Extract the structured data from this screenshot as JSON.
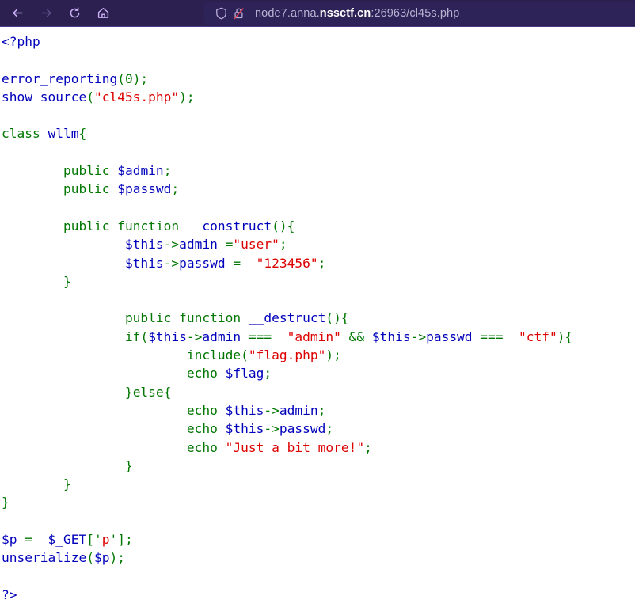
{
  "browser": {
    "back_label": "Back",
    "forward_label": "Forward",
    "reload_label": "Reload",
    "home_label": "Home",
    "shield_label": "Enhanced Tracking Protection",
    "lock_label": "Connection is not secure",
    "url_full": "node7.anna.nssctf.cn:26963/cl45s.php",
    "url_prefix": "node7.anna.",
    "url_host_strong": "nssctf.cn",
    "url_suffix": ":26963/cl45s.php",
    "icons": {
      "back": "arrow-left-icon",
      "forward": "arrow-right-icon",
      "reload": "reload-icon",
      "home": "home-icon",
      "shield": "shield-icon",
      "lock": "lock-crossed-icon"
    },
    "colors": {
      "chrome_bg": "#2b2050",
      "urlbar_bg": "#2e2358",
      "icon": "#c7a8f0",
      "url_text": "#b7b2d0",
      "url_host": "#ffffff"
    }
  },
  "page": {
    "title": "cl45s.php source",
    "colors": {
      "default": "#0000bb",
      "keyword": "#007700",
      "string": "#dd0000",
      "background": "#ffffff"
    },
    "code_lines": [
      [
        {
          "t": "<?php",
          "c": "default"
        }
      ],
      [],
      [
        {
          "t": "error_reporting",
          "c": "default"
        },
        {
          "t": "(",
          "c": "keyword"
        },
        {
          "t": "0",
          "c": "keyword"
        },
        {
          "t": ");",
          "c": "keyword"
        }
      ],
      [
        {
          "t": "show_source",
          "c": "default"
        },
        {
          "t": "(",
          "c": "keyword"
        },
        {
          "t": "\"cl45s.php\"",
          "c": "string"
        },
        {
          "t": ");",
          "c": "keyword"
        }
      ],
      [],
      [
        {
          "t": "class",
          "c": "keyword"
        },
        {
          "t": " ",
          "c": "keyword"
        },
        {
          "t": "wllm",
          "c": "default"
        },
        {
          "t": "{",
          "c": "keyword"
        }
      ],
      [],
      [
        {
          "t": "        ",
          "c": "keyword"
        },
        {
          "t": "public",
          "c": "keyword"
        },
        {
          "t": " ",
          "c": "keyword"
        },
        {
          "t": "$admin",
          "c": "default"
        },
        {
          "t": ";",
          "c": "keyword"
        }
      ],
      [
        {
          "t": "        ",
          "c": "keyword"
        },
        {
          "t": "public",
          "c": "keyword"
        },
        {
          "t": " ",
          "c": "keyword"
        },
        {
          "t": "$passwd",
          "c": "default"
        },
        {
          "t": ";",
          "c": "keyword"
        }
      ],
      [],
      [
        {
          "t": "        ",
          "c": "keyword"
        },
        {
          "t": "public",
          "c": "keyword"
        },
        {
          "t": " ",
          "c": "keyword"
        },
        {
          "t": "function",
          "c": "keyword"
        },
        {
          "t": " ",
          "c": "keyword"
        },
        {
          "t": "__construct",
          "c": "default"
        },
        {
          "t": "(){",
          "c": "keyword"
        }
      ],
      [
        {
          "t": "                ",
          "c": "keyword"
        },
        {
          "t": "$this",
          "c": "default"
        },
        {
          "t": "->",
          "c": "keyword"
        },
        {
          "t": "admin",
          "c": "default"
        },
        {
          "t": " =",
          "c": "keyword"
        },
        {
          "t": "\"user\"",
          "c": "string"
        },
        {
          "t": ";",
          "c": "keyword"
        }
      ],
      [
        {
          "t": "                ",
          "c": "keyword"
        },
        {
          "t": "$this",
          "c": "default"
        },
        {
          "t": "->",
          "c": "keyword"
        },
        {
          "t": "passwd",
          "c": "default"
        },
        {
          "t": " = ",
          "c": "keyword"
        },
        {
          "t": " \"123456\"",
          "c": "string"
        },
        {
          "t": ";",
          "c": "keyword"
        }
      ],
      [
        {
          "t": "        }",
          "c": "keyword"
        }
      ],
      [],
      [
        {
          "t": "                ",
          "c": "keyword"
        },
        {
          "t": "public",
          "c": "keyword"
        },
        {
          "t": " ",
          "c": "keyword"
        },
        {
          "t": "function",
          "c": "keyword"
        },
        {
          "t": " ",
          "c": "keyword"
        },
        {
          "t": "__destruct",
          "c": "default"
        },
        {
          "t": "(){",
          "c": "keyword"
        }
      ],
      [
        {
          "t": "                ",
          "c": "keyword"
        },
        {
          "t": "if",
          "c": "keyword"
        },
        {
          "t": "(",
          "c": "keyword"
        },
        {
          "t": "$this",
          "c": "default"
        },
        {
          "t": "->",
          "c": "keyword"
        },
        {
          "t": "admin",
          "c": "default"
        },
        {
          "t": " === ",
          "c": "keyword"
        },
        {
          "t": " \"admin\"",
          "c": "string"
        },
        {
          "t": " && ",
          "c": "keyword"
        },
        {
          "t": "$this",
          "c": "default"
        },
        {
          "t": "->",
          "c": "keyword"
        },
        {
          "t": "passwd",
          "c": "default"
        },
        {
          "t": " === ",
          "c": "keyword"
        },
        {
          "t": " \"ctf\"",
          "c": "string"
        },
        {
          "t": "){",
          "c": "keyword"
        }
      ],
      [
        {
          "t": "                        ",
          "c": "keyword"
        },
        {
          "t": "include",
          "c": "keyword"
        },
        {
          "t": "(",
          "c": "keyword"
        },
        {
          "t": "\"flag.php\"",
          "c": "string"
        },
        {
          "t": ");",
          "c": "keyword"
        }
      ],
      [
        {
          "t": "                        ",
          "c": "keyword"
        },
        {
          "t": "echo",
          "c": "keyword"
        },
        {
          "t": " ",
          "c": "keyword"
        },
        {
          "t": "$flag",
          "c": "default"
        },
        {
          "t": ";",
          "c": "keyword"
        }
      ],
      [
        {
          "t": "                }",
          "c": "keyword"
        },
        {
          "t": "else",
          "c": "keyword"
        },
        {
          "t": "{",
          "c": "keyword"
        }
      ],
      [
        {
          "t": "                        ",
          "c": "keyword"
        },
        {
          "t": "echo",
          "c": "keyword"
        },
        {
          "t": " ",
          "c": "keyword"
        },
        {
          "t": "$this",
          "c": "default"
        },
        {
          "t": "->",
          "c": "keyword"
        },
        {
          "t": "admin",
          "c": "default"
        },
        {
          "t": ";",
          "c": "keyword"
        }
      ],
      [
        {
          "t": "                        ",
          "c": "keyword"
        },
        {
          "t": "echo",
          "c": "keyword"
        },
        {
          "t": " ",
          "c": "keyword"
        },
        {
          "t": "$this",
          "c": "default"
        },
        {
          "t": "->",
          "c": "keyword"
        },
        {
          "t": "passwd",
          "c": "default"
        },
        {
          "t": ";",
          "c": "keyword"
        }
      ],
      [
        {
          "t": "                        ",
          "c": "keyword"
        },
        {
          "t": "echo",
          "c": "keyword"
        },
        {
          "t": " ",
          "c": "keyword"
        },
        {
          "t": "\"Just a bit more!\"",
          "c": "string"
        },
        {
          "t": ";",
          "c": "keyword"
        }
      ],
      [
        {
          "t": "                }",
          "c": "keyword"
        }
      ],
      [
        {
          "t": "        }",
          "c": "keyword"
        }
      ],
      [
        {
          "t": "}",
          "c": "keyword"
        }
      ],
      [],
      [
        {
          "t": "$p",
          "c": "default"
        },
        {
          "t": " = ",
          "c": "keyword"
        },
        {
          "t": " ",
          "c": "keyword"
        },
        {
          "t": "$_GET",
          "c": "default"
        },
        {
          "t": "[",
          "c": "keyword"
        },
        {
          "t": "'",
          "c": "keyword"
        },
        {
          "t": "p",
          "c": "string"
        },
        {
          "t": "'",
          "c": "keyword"
        },
        {
          "t": "];",
          "c": "keyword"
        }
      ],
      [
        {
          "t": "unserialize",
          "c": "default"
        },
        {
          "t": "(",
          "c": "keyword"
        },
        {
          "t": "$p",
          "c": "default"
        },
        {
          "t": ");",
          "c": "keyword"
        }
      ],
      [],
      [
        {
          "t": "?>",
          "c": "default"
        }
      ]
    ]
  }
}
